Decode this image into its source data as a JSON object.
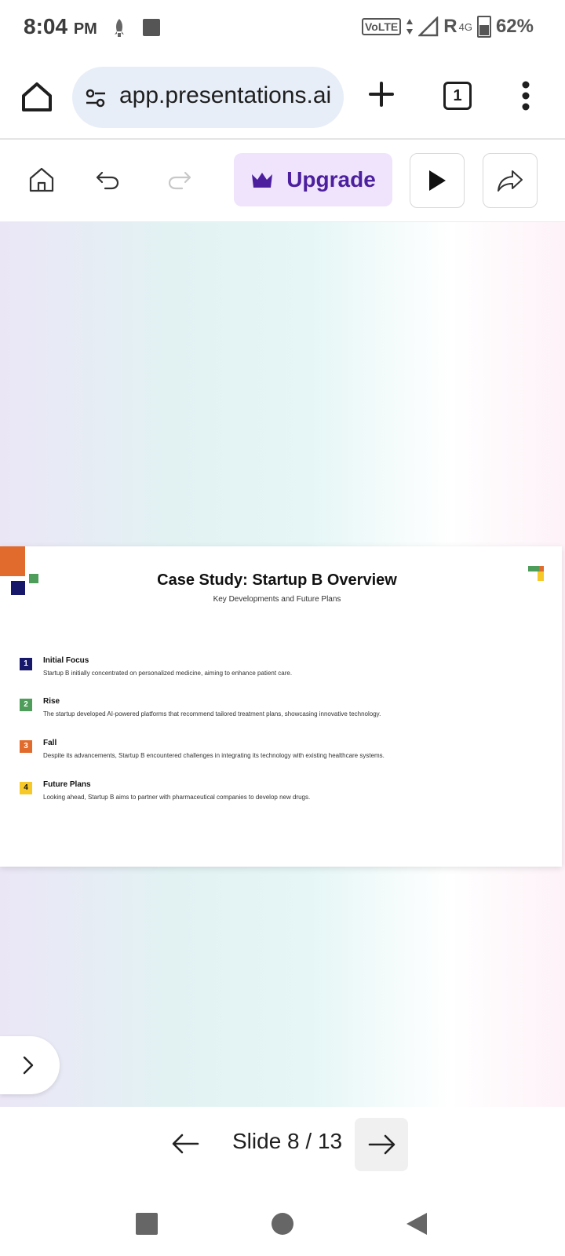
{
  "status_bar": {
    "time": "8:04",
    "ampm": "PM",
    "network": "VoLTE",
    "roaming": "R",
    "gen": "4G",
    "battery": "62%"
  },
  "browser": {
    "url": "app.presentations.ai",
    "tab_count": "1"
  },
  "toolbar": {
    "upgrade_label": "Upgrade"
  },
  "slide": {
    "title": "Case Study: Startup B Overview",
    "subtitle": "Key Developments and Future Plans",
    "items": [
      {
        "num": "1",
        "color": "#17186a",
        "text_color": "#ffffff",
        "heading": "Initial Focus",
        "desc": "Startup B initially concentrated on personalized medicine, aiming to enhance patient care."
      },
      {
        "num": "2",
        "color": "#4f9d5a",
        "text_color": "#ffffff",
        "heading": "Rise",
        "desc": "The startup developed AI-powered platforms that recommend tailored treatment plans, showcasing innovative technology."
      },
      {
        "num": "3",
        "color": "#e16b2d",
        "text_color": "#ffffff",
        "heading": "Fall",
        "desc": "Despite its advancements, Startup B encountered challenges in integrating its technology with existing healthcare systems."
      },
      {
        "num": "4",
        "color": "#f7c928",
        "text_color": "#111111",
        "heading": "Future Plans",
        "desc": "Looking ahead, Startup B aims to partner with pharmaceutical companies to develop new drugs."
      }
    ]
  },
  "slide_nav": {
    "counter": "Slide 8 / 13"
  },
  "colors": {
    "accent": "#4c1f9e",
    "upgrade_bg": "#efe4fb"
  }
}
